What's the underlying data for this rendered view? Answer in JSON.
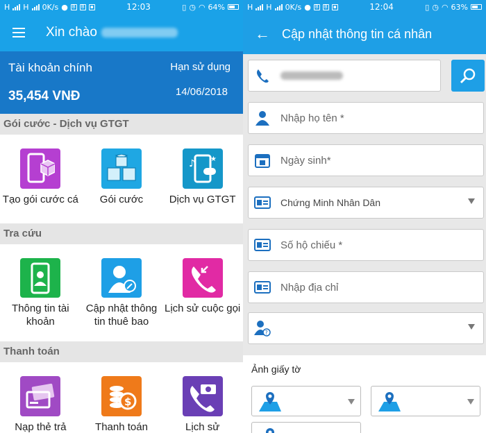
{
  "left": {
    "status": {
      "carrier": "H",
      "speed": "0K/s",
      "time": "12:03",
      "battery": "64%"
    },
    "header": {
      "greeting": "Xin chào"
    },
    "account": {
      "title": "Tài khoản chính",
      "balance": "35,454 VNĐ",
      "expiry_label": "Hạn sử dụng",
      "expiry_date": "14/06/2018"
    },
    "sections": [
      {
        "title": "Gói cước - Dịch vụ GTGT",
        "items": [
          {
            "label": "Tạo gói cước cá",
            "icon": "phone-cube-icon",
            "color": "#b53fd1"
          },
          {
            "label": "Gói cước",
            "icon": "cubes-icon",
            "color": "#1fa7e3"
          },
          {
            "label": "Dịch vụ GTGT",
            "icon": "media-phone-icon",
            "color": "#1597c9"
          }
        ]
      },
      {
        "title": "Tra cứu",
        "items": [
          {
            "label": "Thông tin tài khoản",
            "icon": "account-phone-icon",
            "color": "#1db34b"
          },
          {
            "label": "Cập nhật thông tin thuê bao",
            "icon": "user-edit-icon",
            "color": "#1e9fe6"
          },
          {
            "label": "Lịch sử cuộc gọi",
            "icon": "call-history-icon",
            "color": "#e12aa4"
          }
        ]
      },
      {
        "title": "Thanh toán",
        "items": [
          {
            "label": "Nạp thẻ trả",
            "icon": "card-topup-icon",
            "color": "#a04ac4"
          },
          {
            "label": "Thanh toán",
            "icon": "coins-icon",
            "color": "#ef7a1a"
          },
          {
            "label": "Lịch sử",
            "icon": "payment-history-icon",
            "color": "#6a3fb5"
          }
        ]
      }
    ]
  },
  "right": {
    "status": {
      "carrier": "H",
      "speed": "0K/s",
      "time": "12:04",
      "battery": "63%"
    },
    "header": {
      "title": "Cập nhật thông tin cá nhân"
    },
    "fields": {
      "name": "Nhập họ tên *",
      "birthday": "Ngày sinh*",
      "id_type": "Chứng Minh Nhân Dân",
      "passport": "Số hộ chiếu *",
      "address": "Nhập địa chỉ"
    },
    "photo_label": "Ảnh giấy tờ"
  },
  "colors": {
    "primary": "#1e9fe6",
    "account_bg": "#1878c8",
    "icon_blue": "#1c6fbf"
  }
}
